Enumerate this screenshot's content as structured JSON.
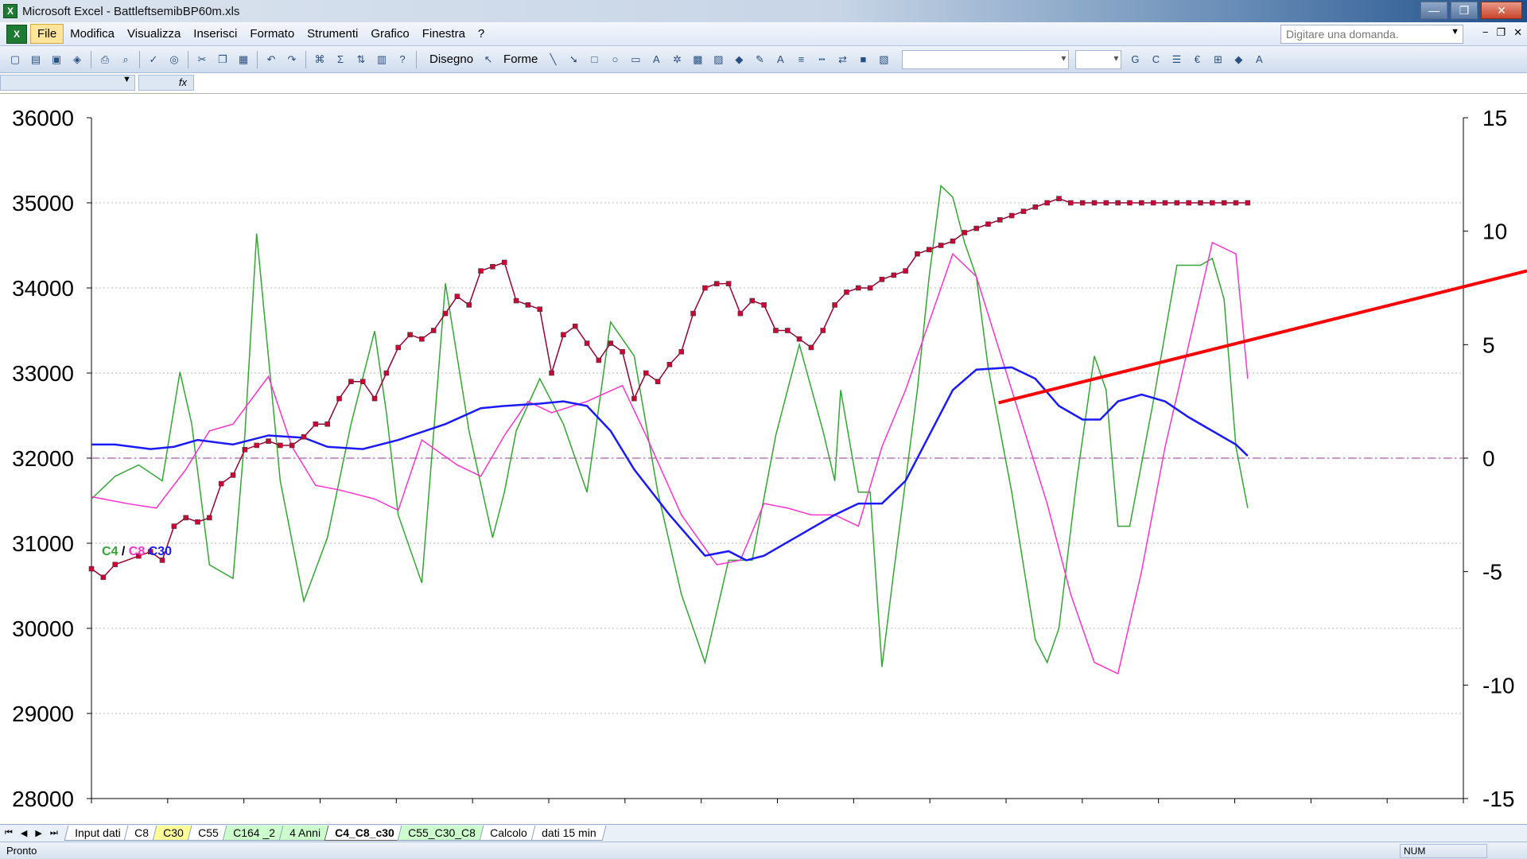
{
  "window": {
    "title": "Microsoft Excel - BattleftsemibBP60m.xls",
    "controls": [
      "—",
      "❐",
      "✕"
    ]
  },
  "menu": {
    "items": [
      "File",
      "Modifica",
      "Visualizza",
      "Inserisci",
      "Formato",
      "Strumenti",
      "Grafico",
      "Finestra",
      "?"
    ],
    "ask_placeholder": "Digitare una domanda.",
    "doc_controls": [
      "−",
      "❐",
      "✕"
    ]
  },
  "toolbar": {
    "drawing_label": "Disegno",
    "shapes_label": "Forme",
    "sum_symbol": "Σ",
    "euro_symbol": "€",
    "bold_label": "G",
    "italic_label": "C"
  },
  "formula_bar": {
    "fx": "fx"
  },
  "chart_data": {
    "type": "line",
    "legend": {
      "c4": "C4",
      "sep": " / ",
      "c8": "C8",
      "c30": "C30",
      "placement": "left"
    },
    "left_axis": {
      "ticks": [
        "36000",
        "35000",
        "34000",
        "33000",
        "32000",
        "31000",
        "30000",
        "29000",
        "28000"
      ],
      "ylim": [
        28000,
        36000
      ]
    },
    "right_axis": {
      "ticks": [
        "15",
        "10",
        "5",
        "0",
        "-5",
        "-10",
        "-15"
      ],
      "ylim": [
        -15,
        15
      ]
    },
    "grid": true,
    "colors": {
      "price": "#990033",
      "price_marker": "#cc0033",
      "c4": "#33a633",
      "c8": "#ff33cc",
      "c30": "#1a1aff",
      "trend": "#ff0000",
      "zero": "#993399"
    },
    "trendline": {
      "x": [
        0.67,
        1.0
      ],
      "y": [
        32650,
        34200
      ]
    },
    "series": [
      {
        "key": "c4",
        "axis": "right",
        "x": [
          0,
          0.02,
          0.04,
          0.06,
          0.075,
          0.085,
          0.1,
          0.12,
          0.13,
          0.14,
          0.16,
          0.18,
          0.2,
          0.22,
          0.24,
          0.25,
          0.26,
          0.28,
          0.3,
          0.32,
          0.34,
          0.35,
          0.36,
          0.38,
          0.4,
          0.42,
          0.44,
          0.46,
          0.48,
          0.5,
          0.52,
          0.54,
          0.56,
          0.58,
          0.6,
          0.62,
          0.63,
          0.635,
          0.64,
          0.65,
          0.66,
          0.67,
          0.68,
          0.7,
          0.71,
          0.72,
          0.73,
          0.74,
          0.75,
          0.76,
          0.78,
          0.8,
          0.81,
          0.82,
          0.835,
          0.85,
          0.86,
          0.87,
          0.88,
          0.9,
          0.92,
          0.94,
          0.95,
          0.96,
          0.97,
          0.98
        ],
        "y": [
          -1.8,
          -0.8,
          -0.3,
          -1.0,
          3.8,
          1.5,
          -4.7,
          -5.3,
          1.0,
          9.9,
          -1.0,
          -6.3,
          -3.5,
          1.5,
          5.6,
          2.0,
          -2.5,
          -5.5,
          7.7,
          1.2,
          -3.5,
          -1.5,
          1.2,
          3.5,
          1.5,
          -1.5,
          6.0,
          4.5,
          -1.5,
          -6.0,
          -9.0,
          -4.5,
          -4.5,
          1.0,
          5.0,
          1.2,
          -1.0,
          3.0,
          1.5,
          -1.5,
          -1.5,
          -9.2,
          -5.0,
          3.0,
          8.0,
          12.0,
          11.5,
          9.5,
          8.0,
          4.0,
          -1.5,
          -8.0,
          -9.0,
          -7.5,
          -1.0,
          4.5,
          3.0,
          -3.0,
          -3.0,
          2.5,
          8.5,
          8.5,
          8.8,
          7.0,
          0.5,
          -2.2
        ]
      },
      {
        "key": "c8",
        "axis": "right",
        "x": [
          0,
          0.03,
          0.055,
          0.08,
          0.1,
          0.12,
          0.15,
          0.17,
          0.19,
          0.21,
          0.24,
          0.26,
          0.28,
          0.31,
          0.33,
          0.35,
          0.37,
          0.39,
          0.42,
          0.45,
          0.47,
          0.5,
          0.53,
          0.55,
          0.57,
          0.59,
          0.61,
          0.63,
          0.65,
          0.67,
          0.69,
          0.71,
          0.73,
          0.75,
          0.78,
          0.81,
          0.83,
          0.85,
          0.87,
          0.89,
          0.91,
          0.93,
          0.95,
          0.97,
          0.98
        ],
        "y": [
          -1.7,
          -2.0,
          -2.2,
          -0.5,
          1.2,
          1.5,
          3.6,
          0.5,
          -1.2,
          -1.4,
          -1.8,
          -2.3,
          0.8,
          -0.3,
          -0.8,
          1.0,
          2.5,
          2.0,
          2.5,
          3.2,
          1.0,
          -2.5,
          -4.7,
          -4.5,
          -2.0,
          -2.2,
          -2.5,
          -2.5,
          -3.0,
          0.5,
          3.0,
          6.0,
          9.0,
          8.0,
          3.0,
          -2.0,
          -6.0,
          -9.0,
          -9.5,
          -5.0,
          0.5,
          5.0,
          9.5,
          9.0,
          3.5
        ]
      },
      {
        "key": "c30",
        "axis": "right",
        "x": [
          0,
          0.02,
          0.05,
          0.07,
          0.09,
          0.12,
          0.15,
          0.18,
          0.2,
          0.23,
          0.26,
          0.3,
          0.33,
          0.35,
          0.38,
          0.4,
          0.42,
          0.44,
          0.46,
          0.49,
          0.52,
          0.54,
          0.555,
          0.57,
          0.59,
          0.61,
          0.63,
          0.65,
          0.67,
          0.69,
          0.71,
          0.73,
          0.75,
          0.78,
          0.8,
          0.82,
          0.84,
          0.855,
          0.87,
          0.89,
          0.91,
          0.93,
          0.95,
          0.97,
          0.98
        ],
        "y": [
          0.6,
          0.6,
          0.4,
          0.5,
          0.8,
          0.6,
          1.0,
          0.9,
          0.5,
          0.4,
          0.8,
          1.5,
          2.2,
          2.3,
          2.4,
          2.5,
          2.3,
          1.2,
          -0.5,
          -2.5,
          -4.3,
          -4.1,
          -4.5,
          -4.3,
          -3.7,
          -3.1,
          -2.5,
          -2.0,
          -2.0,
          -1.0,
          1.0,
          3.0,
          3.9,
          4.0,
          3.5,
          2.3,
          1.7,
          1.7,
          2.5,
          2.8,
          2.5,
          1.8,
          1.2,
          0.6,
          0.1
        ]
      },
      {
        "key": "price",
        "axis": "left",
        "x": [
          0,
          0.01,
          0.02,
          0.04,
          0.05,
          0.06,
          0.07,
          0.08,
          0.09,
          0.1,
          0.11,
          0.12,
          0.13,
          0.14,
          0.15,
          0.16,
          0.17,
          0.18,
          0.19,
          0.2,
          0.21,
          0.22,
          0.23,
          0.24,
          0.25,
          0.26,
          0.27,
          0.28,
          0.29,
          0.3,
          0.31,
          0.32,
          0.33,
          0.34,
          0.35,
          0.36,
          0.37,
          0.38,
          0.39,
          0.4,
          0.41,
          0.42,
          0.43,
          0.44,
          0.45,
          0.46,
          0.47,
          0.48,
          0.49,
          0.5,
          0.51,
          0.52,
          0.53,
          0.54,
          0.55,
          0.56,
          0.57,
          0.58,
          0.59,
          0.6,
          0.61,
          0.62,
          0.63,
          0.64,
          0.65,
          0.66,
          0.67,
          0.68,
          0.69,
          0.7,
          0.71,
          0.72,
          0.73,
          0.74,
          0.75,
          0.76,
          0.77,
          0.78,
          0.79,
          0.8,
          0.81,
          0.82,
          0.83,
          0.84,
          0.85,
          0.86,
          0.87,
          0.88,
          0.89,
          0.9,
          0.91,
          0.92,
          0.93,
          0.94,
          0.95,
          0.96,
          0.97,
          0.98
        ],
        "y": [
          30700,
          30600,
          30750,
          30850,
          30900,
          30800,
          31200,
          31300,
          31250,
          31300,
          31700,
          31800,
          32100,
          32150,
          32200,
          32150,
          32150,
          32250,
          32400,
          32400,
          32700,
          32900,
          32900,
          32700,
          33000,
          33300,
          33450,
          33400,
          33500,
          33700,
          33900,
          33800,
          34200,
          34250,
          34300,
          33850,
          33800,
          33750,
          33000,
          33450,
          33550,
          33350,
          33150,
          33350,
          33250,
          32700,
          33000,
          32900,
          33100,
          33250,
          33700,
          34000,
          34050,
          34050,
          33700,
          33850,
          33800,
          33500,
          33500,
          33400,
          33300,
          33500,
          33800,
          33950,
          34000,
          34000,
          34100,
          34150,
          34200,
          34400,
          34450,
          34500,
          34550,
          34650,
          34700,
          34750,
          34800,
          34850,
          34900,
          34950,
          35000,
          35050,
          35000,
          35000,
          35000,
          35000,
          35000,
          35000,
          35000,
          35000,
          35000,
          35000,
          35000,
          35000,
          35000,
          35000,
          35000,
          35000
        ]
      }
    ]
  },
  "sheet_tabs": {
    "nav": [
      "⏮",
      "◀",
      "▶",
      "⏭"
    ],
    "tabs": [
      {
        "label": "Input dati",
        "color": "white"
      },
      {
        "label": "C8",
        "color": "white"
      },
      {
        "label": "C30",
        "color": "yellow"
      },
      {
        "label": "C55",
        "color": "white"
      },
      {
        "label": "C164 _2",
        "color": "green"
      },
      {
        "label": "4 Anni",
        "color": "green"
      },
      {
        "label": "C4_C8_c30",
        "color": "active"
      },
      {
        "label": "C55_C30_C8",
        "color": "green"
      },
      {
        "label": "Calcolo",
        "color": "white"
      },
      {
        "label": "dati 15 min",
        "color": "white"
      }
    ]
  },
  "status": {
    "text": "Pronto",
    "num": "NUM"
  }
}
